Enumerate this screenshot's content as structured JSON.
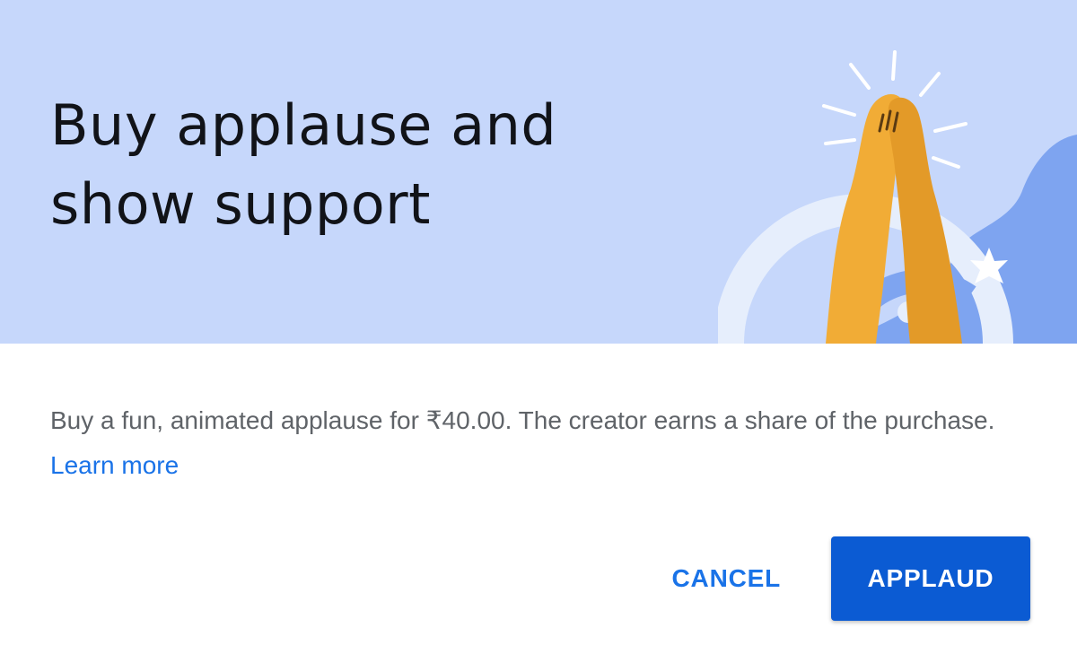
{
  "dialog": {
    "title": "Buy applause and show support",
    "body_text": "Buy a fun, animated applause for ₹40.00. The creator earns a share of the purchase. ",
    "learn_more_label": "Learn more"
  },
  "actions": {
    "cancel_label": "CANCEL",
    "applaud_label": "APPLAUD"
  },
  "icons": {
    "illustration": "applause-hands-icon",
    "sparkle": "sparkle-icon"
  },
  "colors": {
    "banner_bg": "#c6d7fb",
    "accent": "#1a73e8",
    "primary_button": "#0b5bd3",
    "title_text": "#111318",
    "body_text": "#5f6368"
  }
}
